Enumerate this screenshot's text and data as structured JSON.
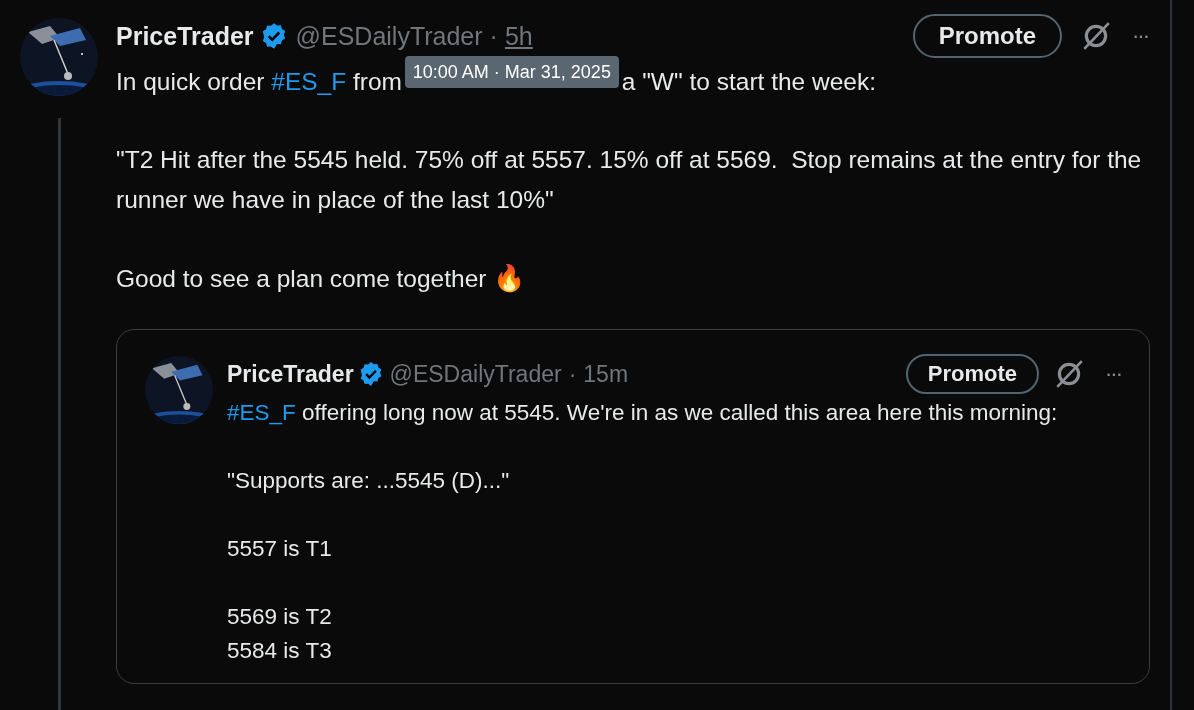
{
  "post": {
    "name": "PriceTrader",
    "verified": true,
    "handle": "@ESDailyTrader",
    "separator": "·",
    "time": "5h",
    "promote": "Promote",
    "more": "···",
    "paragraphs": [
      [
        {
          "kind": "text",
          "text": "In quick order "
        },
        {
          "kind": "hashtag",
          "text": "#ES_F"
        },
        {
          "kind": "text",
          "text": " from "
        },
        {
          "kind": "tooltip",
          "text": "10:00 AM · Mar 31, 2025"
        },
        {
          "kind": "text",
          "text": " a \"W\" to start the week:"
        }
      ],
      [
        {
          "kind": "text",
          "text": "\"T2 Hit after the 5545 held. 75% off at 5557. 15% off at 5569.  Stop remains at the entry for the runner we have in place of the last 10%\""
        }
      ],
      [
        {
          "kind": "text",
          "text": "Good to see a plan come together "
        },
        {
          "kind": "emoji",
          "text": "🔥"
        }
      ]
    ],
    "quote": {
      "name": "PriceTrader",
      "verified": true,
      "handle": "@ESDailyTrader",
      "separator": "·",
      "time": "15m",
      "promote": "Promote",
      "more": "···",
      "paragraphs": [
        [
          {
            "kind": "hashtag",
            "text": "#ES_F"
          },
          {
            "kind": "text",
            "text": " offering long now at 5545. We're in as we called this area here this morning:"
          }
        ],
        [
          {
            "kind": "text",
            "text": "\"Supports are: ...5545 (D)...\""
          }
        ],
        [
          {
            "kind": "text",
            "text": "5557 is T1"
          }
        ],
        [
          {
            "kind": "text",
            "text": "5569 is T2"
          }
        ],
        [
          {
            "kind": "text",
            "text": "5584 is T3"
          }
        ]
      ]
    }
  }
}
